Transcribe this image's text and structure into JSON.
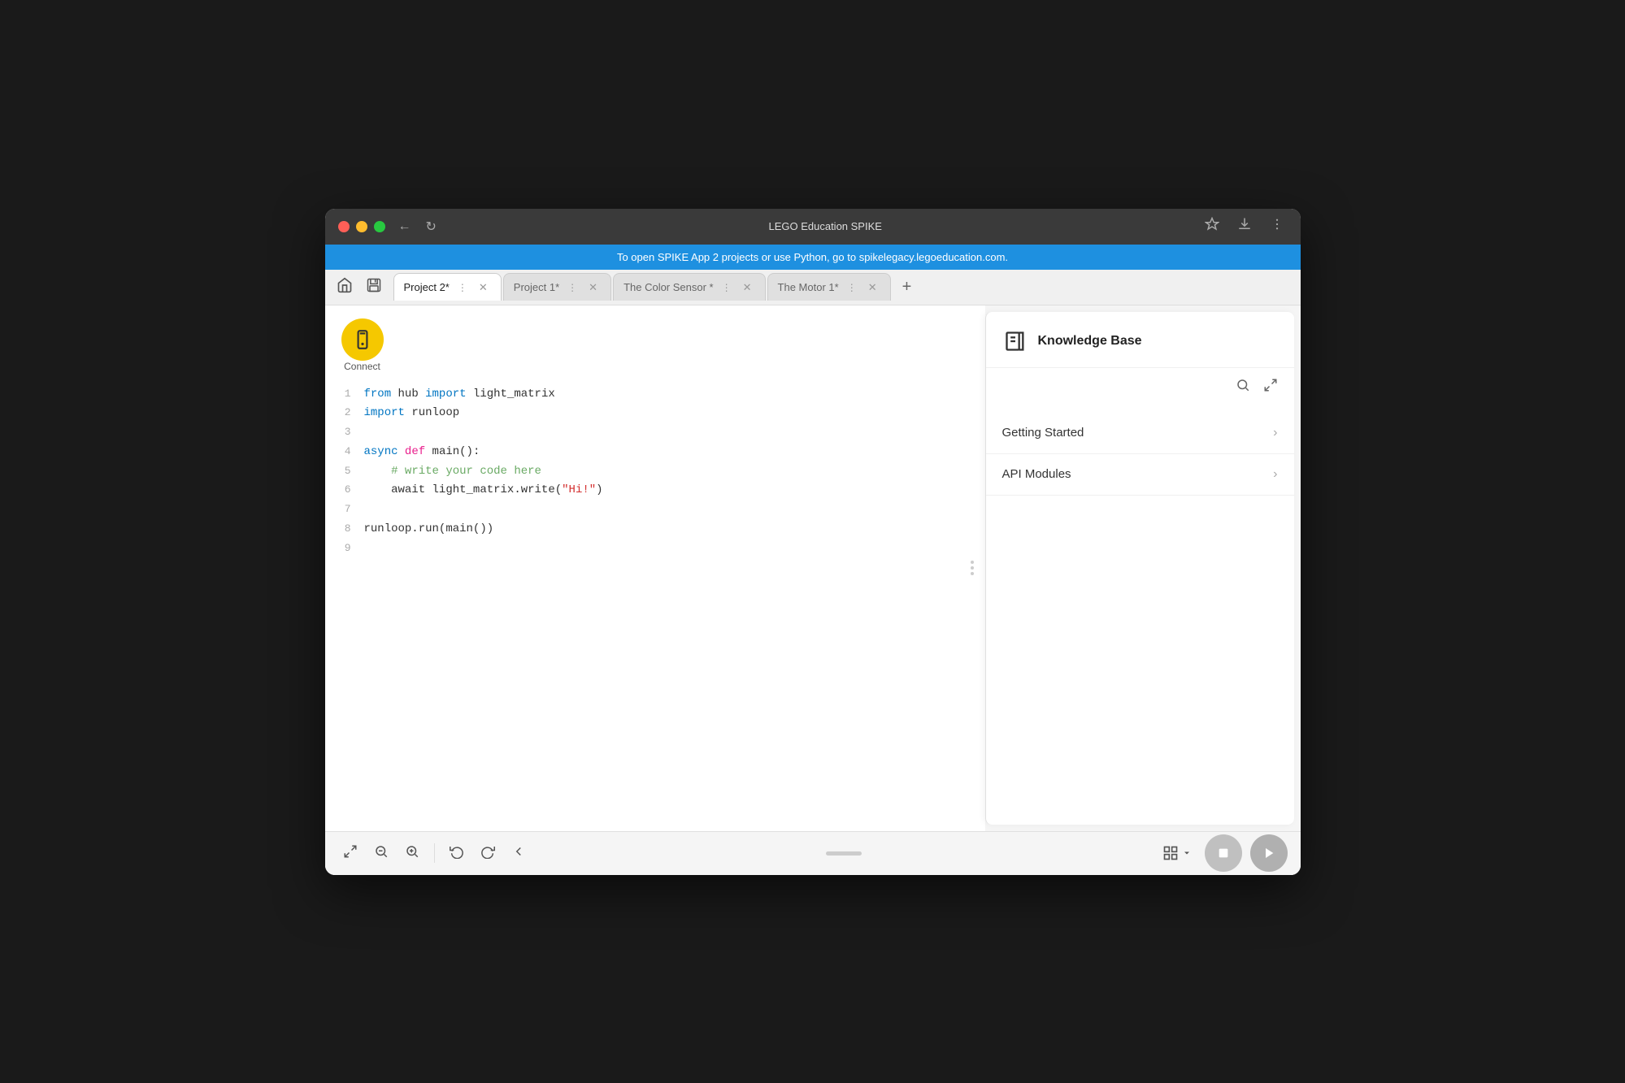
{
  "titlebar": {
    "title": "LEGO Education SPIKE",
    "nav_back": "←",
    "nav_refresh": "↻"
  },
  "banner": {
    "text": "To open SPIKE App 2 projects or use Python, go to spikelegacy.legoeducation.com."
  },
  "tabs": [
    {
      "id": "tab-project2",
      "label": "Project 2*",
      "active": true
    },
    {
      "id": "tab-project1",
      "label": "Project 1*",
      "active": false
    },
    {
      "id": "tab-color-sensor",
      "label": "The Color Sensor *",
      "active": false
    },
    {
      "id": "tab-motor",
      "label": "The Motor 1*",
      "active": false
    }
  ],
  "connect": {
    "label": "Connect"
  },
  "code": {
    "lines": [
      {
        "num": "1",
        "tokens": [
          {
            "text": "from ",
            "cls": "kw-blue"
          },
          {
            "text": "hub ",
            "cls": ""
          },
          {
            "text": "import",
            "cls": "kw-blue"
          },
          {
            "text": " light_matrix",
            "cls": ""
          }
        ]
      },
      {
        "num": "2",
        "tokens": [
          {
            "text": "import",
            "cls": "kw-blue"
          },
          {
            "text": " runloop",
            "cls": ""
          }
        ]
      },
      {
        "num": "3",
        "tokens": []
      },
      {
        "num": "4",
        "tokens": [
          {
            "text": "async",
            "cls": "kw-blue"
          },
          {
            "text": " ",
            "cls": ""
          },
          {
            "text": "def",
            "cls": "kw-pink"
          },
          {
            "text": " main():",
            "cls": ""
          }
        ]
      },
      {
        "num": "5",
        "tokens": [
          {
            "text": "    # write your code here",
            "cls": "kw-comment"
          }
        ]
      },
      {
        "num": "6",
        "tokens": [
          {
            "text": "    await light_matrix.write(",
            "cls": ""
          },
          {
            "text": "\"Hi!\"",
            "cls": "str-red"
          },
          {
            "text": ")",
            "cls": ""
          }
        ]
      },
      {
        "num": "7",
        "tokens": []
      },
      {
        "num": "8",
        "tokens": [
          {
            "text": "runloop.run(main())",
            "cls": ""
          }
        ]
      },
      {
        "num": "9",
        "tokens": []
      }
    ]
  },
  "knowledge_base": {
    "title": "Knowledge Base",
    "search_label": "Search",
    "collapse_label": "Collapse",
    "items": [
      {
        "label": "Getting Started"
      },
      {
        "label": "API Modules"
      }
    ]
  },
  "bottom_toolbar": {
    "fullscreen_label": "Fullscreen",
    "zoom_out_label": "Zoom Out",
    "zoom_in_label": "Zoom In",
    "undo_label": "Undo",
    "redo_label": "Redo",
    "collapse_label": "Collapse Panel",
    "grid_label": "Grid View",
    "stop_label": "Stop",
    "play_label": "Play"
  }
}
